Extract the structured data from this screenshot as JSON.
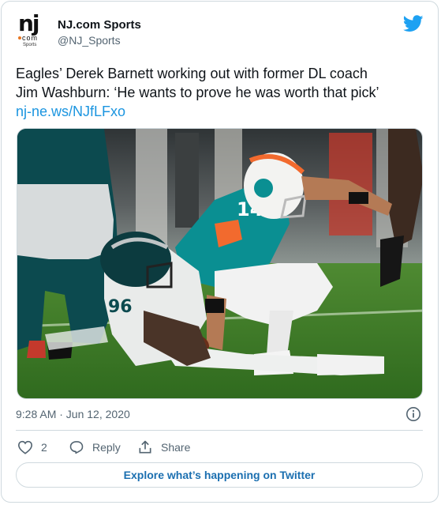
{
  "account": {
    "logo_text": "nj",
    "logo_sub": "com",
    "logo_sports": "Sports",
    "display_name": "NJ.com Sports",
    "handle": "@NJ_Sports"
  },
  "tweet": {
    "line1": "Eagles’ Derek Barnett working out with former DL coach",
    "line2": "Jim Washburn: ‘He wants to prove he was worth that pick’",
    "link": "nj-ne.ws/NJfLFxo",
    "timestamp": "9:28 AM · Jun 12, 2020",
    "player_numbers": {
      "qb": "14",
      "defender": "96"
    }
  },
  "actions": {
    "like_count": "2",
    "reply_label": "Reply",
    "share_label": "Share"
  },
  "explore_label": "Explore what’s happening on Twitter",
  "colors": {
    "twitter_blue": "#1da1f2",
    "link_blue": "#1b95e0",
    "muted": "#536471",
    "dolphins_aqua": "#008e97",
    "dolphins_orange": "#fc4c02",
    "eagles_green": "#004c54"
  }
}
